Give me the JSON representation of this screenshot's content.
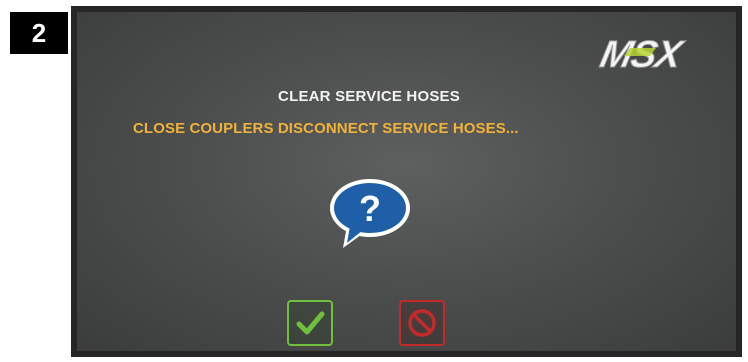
{
  "step": {
    "number": "2"
  },
  "logo": {
    "text": "MSX",
    "icon": "msx-logo"
  },
  "dialog": {
    "title": "CLEAR SERVICE HOSES",
    "message": "CLOSE COUPLERS DISCONNECT SERVICE HOSES...",
    "icon": "question-bubble-icon"
  },
  "buttons": {
    "confirm": {
      "icon": "checkmark-icon"
    },
    "cancel": {
      "icon": "prohibited-icon"
    }
  },
  "colors": {
    "title": "#f2f2f2",
    "message": "#f0b23a",
    "confirm": "#6fc03c",
    "cancel": "#c42a2a",
    "question_bubble": "#1f5fa8",
    "logo_accent": "#b5d334"
  }
}
